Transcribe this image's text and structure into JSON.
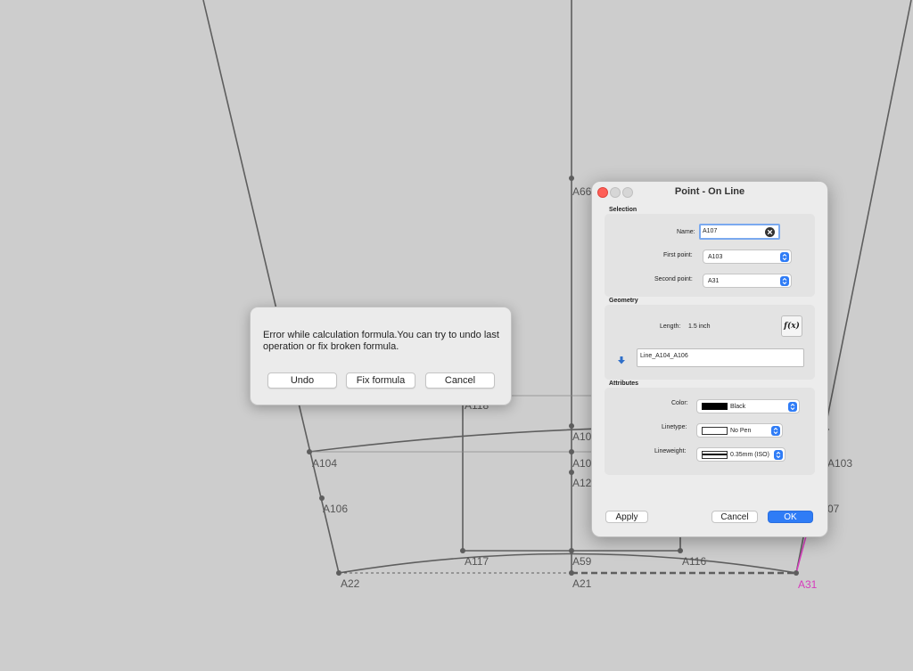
{
  "canvas": {
    "points": {
      "a66": "A66",
      "a118": "A118",
      "a104": "A104",
      "a106": "A106",
      "a10x_1": "A10",
      "a10x_2": "A10",
      "a12x": "A12",
      "a103": "A103",
      "a107_partial": "07",
      "a22": "A22",
      "a117": "A117",
      "a59": "A59",
      "a116": "A116",
      "a21": "A21",
      "a31": "A31"
    }
  },
  "error_dialog": {
    "message": "Error while calculation formula.You can try to undo last operation or fix broken formula.",
    "undo_label": "Undo",
    "fix_label": "Fix formula",
    "cancel_label": "Cancel"
  },
  "dialog": {
    "title": "Point - On Line",
    "selection": {
      "section_title": "Selection",
      "name_label": "Name:",
      "name_value": "A107",
      "first_point_label": "First point:",
      "first_point_value": "A103",
      "second_point_label": "Second point:",
      "second_point_value": "A31"
    },
    "geometry": {
      "section_title": "Geometry",
      "length_label": "Length:",
      "length_value": "1.5 inch",
      "formula_button": "f(x)",
      "formula_value": "Line_A104_A106"
    },
    "attributes": {
      "section_title": "Attributes",
      "color_label": "Color:",
      "color_value": "Black",
      "linetype_label": "Linetype:",
      "linetype_value": "No Pen",
      "lineweight_label": "Lineweight:",
      "lineweight_value": "0.35mm (ISO)"
    },
    "buttons": {
      "apply": "Apply",
      "cancel": "Cancel",
      "ok": "OK"
    }
  },
  "colors": {
    "accent": "#2f7cf6",
    "canvas_bg": "#cdcdcd",
    "line": "#5a5a5a",
    "highlight": "#d63bbd"
  }
}
